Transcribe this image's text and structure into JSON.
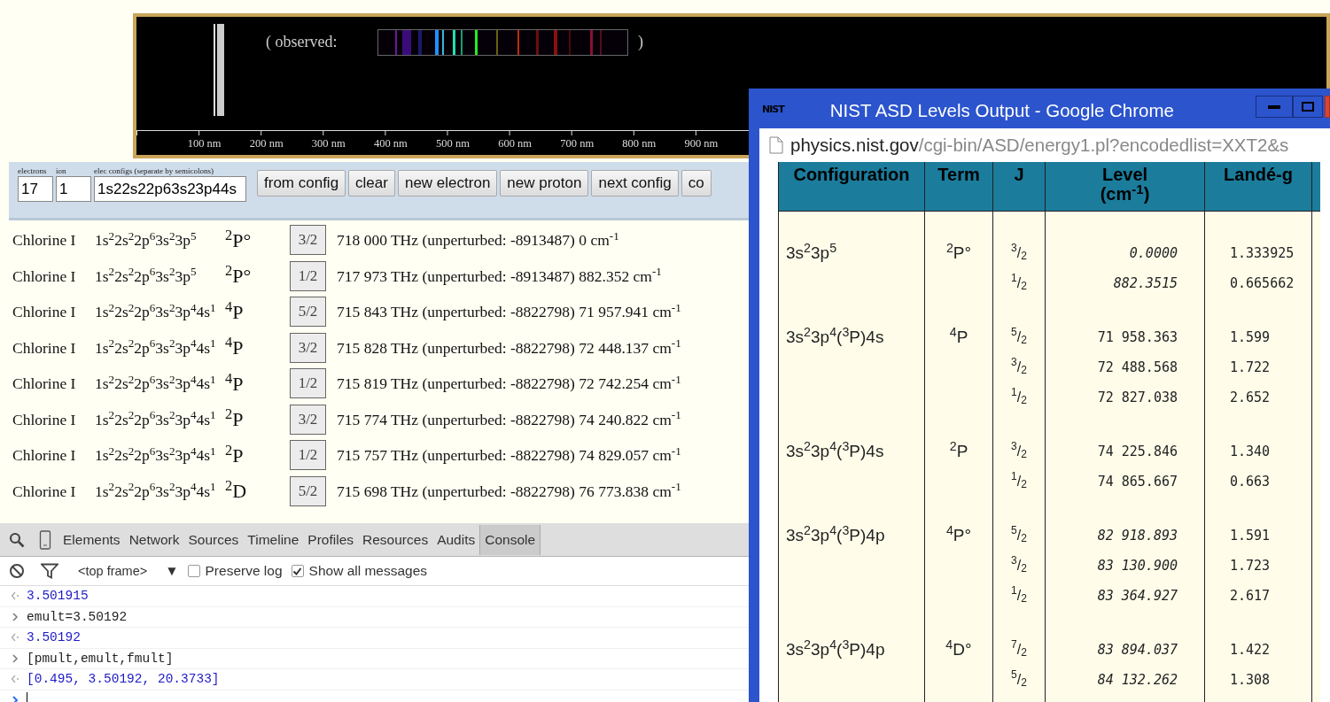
{
  "spectrum": {
    "observed_label": "( observed:",
    "closing_paren": ")",
    "axis_labels": [
      "100 nm",
      "200 nm",
      "300 nm",
      "400 nm",
      "500 nm",
      "600 nm",
      "700 nm",
      "800 nm",
      "900 nm"
    ]
  },
  "controls": {
    "field_labels": [
      "electrons",
      "ion",
      "elec configs (separate by semicolons)"
    ],
    "fields": [
      {
        "value": "17"
      },
      {
        "value": "1"
      },
      {
        "value": "1s22s22p63s23p44s"
      }
    ],
    "buttons": [
      "from config",
      "clear",
      "new electron",
      "new proton",
      "next config",
      "co"
    ]
  },
  "levels": [
    {
      "element": "Chlorine I",
      "configuration": "1s$^{2}$2s$^{2}$2p$^{6}$3s$^{2}$3p$^{5}$",
      "term": "$^{2}$P°",
      "j": "3/2",
      "description": "718 000 THz (unperturbed: -8913487) 0 cm$^{-1}$"
    },
    {
      "element": "Chlorine I",
      "configuration": "1s$^{2}$2s$^{2}$2p$^{6}$3s$^{2}$3p$^{5}$",
      "term": "$^{2}$P°",
      "j": "1/2",
      "description": "717 973 THz (unperturbed: -8913487) 882.352 cm$^{-1}$"
    },
    {
      "element": "Chlorine I",
      "configuration": "1s$^{2}$2s$^{2}$2p$^{6}$3s$^{2}$3p$^{4}$4s$^{1}$",
      "term": "$^{4}$P",
      "j": "5/2",
      "description": "715 843 THz (unperturbed: -8822798) 71 957.941 cm$^{-1}$"
    },
    {
      "element": "Chlorine I",
      "configuration": "1s$^{2}$2s$^{2}$2p$^{6}$3s$^{2}$3p$^{4}$4s$^{1}$",
      "term": "$^{4}$P",
      "j": "3/2",
      "description": "715 828 THz (unperturbed: -8822798) 72 448.137 cm$^{-1}$"
    },
    {
      "element": "Chlorine I",
      "configuration": "1s$^{2}$2s$^{2}$2p$^{6}$3s$^{2}$3p$^{4}$4s$^{1}$",
      "term": "$^{4}$P",
      "j": "1/2",
      "description": "715 819 THz (unperturbed: -8822798) 72 742.254 cm$^{-1}$"
    },
    {
      "element": "Chlorine I",
      "configuration": "1s$^{2}$2s$^{2}$2p$^{6}$3s$^{2}$3p$^{4}$4s$^{1}$",
      "term": "$^{2}$P",
      "j": "3/2",
      "description": "715 774 THz (unperturbed: -8822798) 74 240.822 cm$^{-1}$"
    },
    {
      "element": "Chlorine I",
      "configuration": "1s$^{2}$2s$^{2}$2p$^{6}$3s$^{2}$3p$^{4}$4s$^{1}$",
      "term": "$^{2}$P",
      "j": "1/2",
      "description": "715 757 THz (unperturbed: -8822798) 74 829.057 cm$^{-1}$"
    },
    {
      "element": "Chlorine I",
      "configuration": "1s$^{2}$2s$^{2}$2p$^{6}$3s$^{2}$3p$^{4}$4s$^{1}$",
      "term": "$^{2}$D",
      "j": "5/2",
      "description": "715 698 THz (unperturbed: -8822798) 76 773.838 cm$^{-1}$"
    }
  ],
  "devtools": {
    "tabs": [
      {
        "label": "Elements",
        "selected": false
      },
      {
        "label": "Network",
        "selected": false
      },
      {
        "label": "Sources",
        "selected": false
      },
      {
        "label": "Timeline",
        "selected": false
      },
      {
        "label": "Profiles",
        "selected": false
      },
      {
        "label": "Resources",
        "selected": false
      },
      {
        "label": "Audits",
        "selected": false
      },
      {
        "label": "Console",
        "selected": true
      }
    ],
    "frame_selector": "<top frame>",
    "dropdown_arrow": "▼",
    "checkboxes": [
      {
        "label": "Preserve log",
        "checked": false
      },
      {
        "label": "Show all messages",
        "checked": true
      }
    ],
    "console": [
      {
        "kind": "output",
        "text": "3.501915"
      },
      {
        "kind": "input",
        "text": "emult=3.50192"
      },
      {
        "kind": "output",
        "text": "3.50192"
      },
      {
        "kind": "input",
        "text": "[pmult,emult,fmult]"
      },
      {
        "kind": "output",
        "text": "[0.495, 3.50192, 20.3733]"
      },
      {
        "kind": "prompt"
      }
    ]
  },
  "nist_window": {
    "logo": "NIST",
    "title": "NIST ASD Levels Output - Google Chrome",
    "address_host": "physics.nist.gov",
    "address_path": "/cgi-bin/ASD/energy1.pl?encodedlist=XXT2&s",
    "columns": [
      {
        "label": "Configuration"
      },
      {
        "label": "Term"
      },
      {
        "label": "J"
      },
      {
        "label": "Level",
        "unit": "(cm$^{-1}$)"
      },
      {
        "label": "Landé-g"
      }
    ],
    "groups": [
      {
        "configuration": "3s$^{2}$3p$^{5}$",
        "term": "$^{2}$P°",
        "levels": [
          {
            "j": "$^{3}$/$_{2}$",
            "level": "0.0000",
            "italic": true,
            "lande": "1.333925"
          },
          {
            "j": "$^{1}$/$_{2}$",
            "level": "882.3515",
            "italic": true,
            "lande": "0.665662"
          }
        ]
      },
      {
        "configuration": "3s$^{2}$3p$^{4}$($^{3}$P)4s",
        "term": "$^{4}$P",
        "levels": [
          {
            "j": "$^{5}$/$_{2}$",
            "level": "71 958.363",
            "italic": false,
            "lande": "1.599"
          },
          {
            "j": "$^{3}$/$_{2}$",
            "level": "72 488.568",
            "italic": false,
            "lande": "1.722"
          },
          {
            "j": "$^{1}$/$_{2}$",
            "level": "72 827.038",
            "italic": false,
            "lande": "2.652"
          }
        ]
      },
      {
        "configuration": "3s$^{2}$3p$^{4}$($^{3}$P)4s",
        "term": "$^{2}$P",
        "levels": [
          {
            "j": "$^{3}$/$_{2}$",
            "level": "74 225.846",
            "italic": false,
            "lande": "1.340"
          },
          {
            "j": "$^{1}$/$_{2}$",
            "level": "74 865.667",
            "italic": false,
            "lande": "0.663"
          }
        ]
      },
      {
        "configuration": "3s$^{2}$3p$^{4}$($^{3}$P)4p",
        "term": "$^{4}$P°",
        "levels": [
          {
            "j": "$^{5}$/$_{2}$",
            "level": "82 918.893",
            "italic": true,
            "lande": "1.591"
          },
          {
            "j": "$^{3}$/$_{2}$",
            "level": "83 130.900",
            "italic": true,
            "lande": "1.723"
          },
          {
            "j": "$^{1}$/$_{2}$",
            "level": "83 364.927",
            "italic": true,
            "lande": "2.617"
          }
        ]
      },
      {
        "configuration": "3s$^{2}$3p$^{4}$($^{3}$P)4p",
        "term": "$^{4}$D°",
        "levels": [
          {
            "j": "$^{7}$/$_{2}$",
            "level": "83 894.037",
            "italic": true,
            "lande": "1.422"
          },
          {
            "j": "$^{5}$/$_{2}$",
            "level": "84 132.262",
            "italic": true,
            "lande": "1.308"
          }
        ]
      }
    ]
  }
}
